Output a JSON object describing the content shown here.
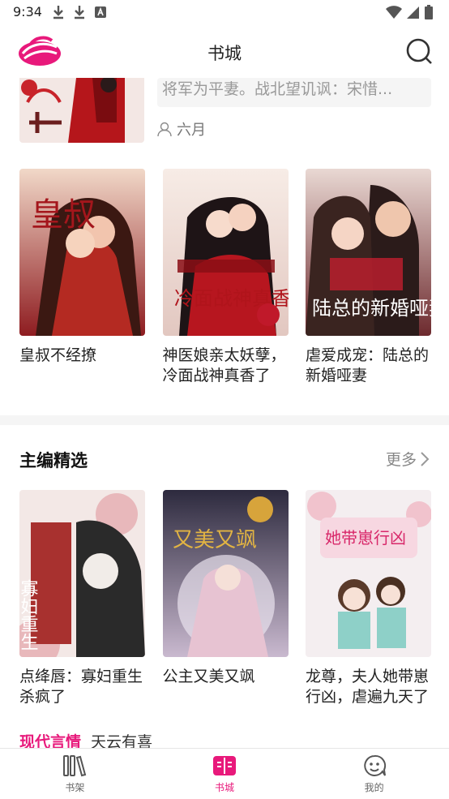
{
  "status_bar": {
    "time": "9:34"
  },
  "header": {
    "title": "书城"
  },
  "top_item": {
    "description": "将军为平妻。战北望讥讽：宋惜...",
    "author": "六月"
  },
  "recommend_row": [
    {
      "title": "皇叔不经撩",
      "cover_text": "皇叔"
    },
    {
      "title": "神医娘亲太妖孽，冷面战神真香了",
      "cover_text": "冷面战神真香了"
    },
    {
      "title": "虐爱成宠：陆总的新婚哑妻",
      "cover_text": "陆总的新婚哑妻"
    }
  ],
  "editor_picks": {
    "title": "主编精选",
    "more": "更多",
    "books": [
      {
        "title": "点绛唇：寡妇重生杀疯了",
        "cover_text": "寡妇重生"
      },
      {
        "title": "公主又美又飒",
        "cover_text": "又美又飒"
      },
      {
        "title": "龙尊，夫人她带崽行凶，虐遍九天了",
        "cover_text": "她带崽行凶"
      }
    ]
  },
  "category_strip": {
    "active": "现代言情",
    "tag": "天云有喜"
  },
  "tab_bar": {
    "tabs": [
      {
        "label": "书架"
      },
      {
        "label": "书城"
      },
      {
        "label": "我的"
      }
    ]
  },
  "colors": {
    "accent": "#e8197b"
  }
}
